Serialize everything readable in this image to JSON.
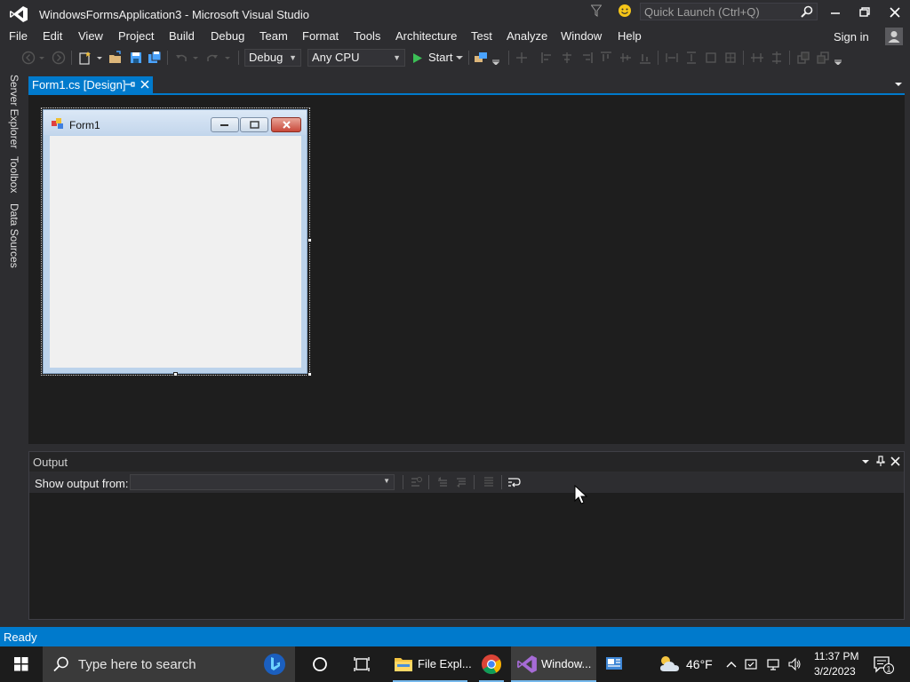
{
  "window": {
    "title": "WindowsFormsApplication3 - Microsoft Visual Studio",
    "quick_launch_placeholder": "Quick Launch (Ctrl+Q)"
  },
  "menu": {
    "items": [
      "File",
      "Edit",
      "View",
      "Project",
      "Build",
      "Debug",
      "Team",
      "Format",
      "Tools",
      "Architecture",
      "Test",
      "Analyze",
      "Window",
      "Help"
    ],
    "sign_in": "Sign in"
  },
  "toolbar": {
    "configuration": "Debug",
    "platform": "Any CPU",
    "start_label": "Start"
  },
  "side_tabs": [
    "Server Explorer",
    "Toolbox",
    "Data Sources"
  ],
  "document_tab": {
    "label": "Form1.cs [Design]"
  },
  "designer": {
    "form_title": "Form1"
  },
  "output": {
    "title": "Output",
    "show_from_label": "Show output from:",
    "show_from_value": ""
  },
  "status": {
    "text": "Ready"
  },
  "taskbar": {
    "search_placeholder": "Type here to search",
    "file_explorer": "File Expl...",
    "vs_app": "Window...",
    "weather_temp": "46°F",
    "time": "11:37 PM",
    "date": "3/2/2023"
  },
  "colors": {
    "accent": "#007acc",
    "background": "#2d2d30",
    "editor": "#1e1e1e"
  }
}
